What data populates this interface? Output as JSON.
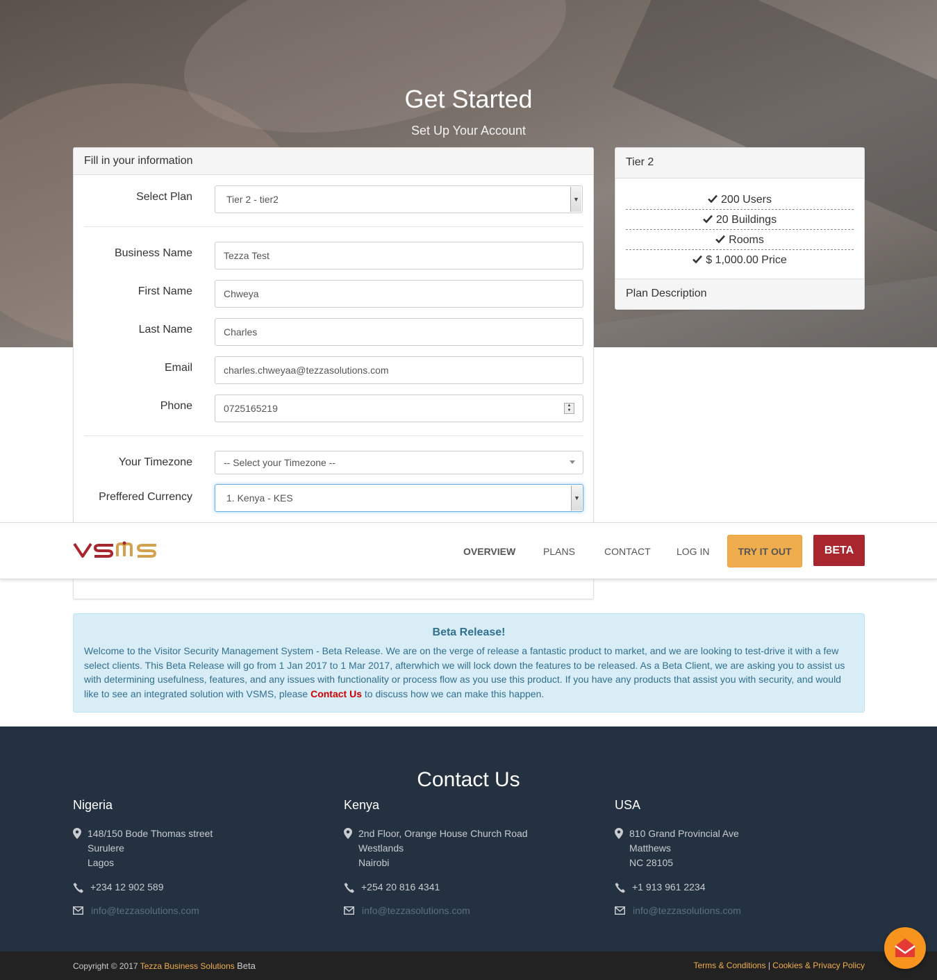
{
  "hero": {
    "title": "Get Started",
    "subtitle": "Set Up Your Account"
  },
  "form": {
    "heading": "Fill in your information",
    "plan_label": "Select Plan",
    "plan_value": "Tier 2 - tier2",
    "business_label": "Business Name",
    "business_value": "Tezza Test",
    "first_label": "First Name",
    "first_value": "Chweya",
    "last_label": "Last Name",
    "last_value": "Charles",
    "email_label": "Email",
    "email_value": "charles.chweyaa@tezzasolutions.com",
    "phone_label": "Phone",
    "phone_value": "0725165219",
    "timezone_label": "Your Timezone",
    "timezone_value": "-- Select your Timezone --",
    "currency_label": "Preffered Currency",
    "currency_value": "1. Kenya - KES"
  },
  "tier": {
    "title": "Tier 2",
    "features": [
      "200 Users",
      "20 Buildings",
      "Rooms",
      "$ 1,000.00 Price"
    ],
    "footer": "Plan Description"
  },
  "nav": {
    "logo": "VSMS",
    "overview": "OVERVIEW",
    "plans": "PLANS",
    "contact": "CONTACT",
    "login": "LOG IN",
    "try": "TRY IT OUT",
    "beta": "BETA"
  },
  "alert": {
    "title": "Beta Release!",
    "text_before": "Welcome to the Visitor Security Management System - Beta Release. We are on the verge of release a fantastic product to market, and we are looking to test-drive it with a few select clients. This Beta Release will go from 1 Jan 2017 to 1 Mar 2017, afterwhich we will lock down the features to be released. As a Beta Client, we are asking you to assist us with determining usefulness, features, and any issues with functionality or process flow as you use this product. If you have any products that assist you with security, and would like to see an integrated solution with VSMS, please ",
    "link": "Contact Us",
    "text_after": " to discuss how we can make this happen."
  },
  "contact": {
    "title": "Contact Us",
    "offices": [
      {
        "country": "Nigeria",
        "addr1": "148/150 Bode Thomas street",
        "addr2": "Surulere",
        "addr3": "Lagos",
        "phone": "+234 12 902 589",
        "email": "info@tezzasolutions.com"
      },
      {
        "country": "Kenya",
        "addr1": "2nd Floor, Orange House Church Road",
        "addr2": "Westlands",
        "addr3": "Nairobi",
        "phone": "+254 20 816 4341",
        "email": "info@tezzasolutions.com"
      },
      {
        "country": "USA",
        "addr1": "810 Grand Provincial Ave",
        "addr2": "Matthews",
        "addr3": "NC 28105",
        "phone": "+1 913 961 2234",
        "email": "info@tezzasolutions.com"
      }
    ]
  },
  "footer": {
    "copyright": "Copyright © 2017",
    "company": "Tezza Business Solutions",
    "beta": "Beta",
    "terms": "Terms & Conditions",
    "privacy": "Cookies & Privacy Policy"
  },
  "colors": {
    "accent": "#f0ad4e",
    "beta": "#a8272e",
    "navy": "#243140",
    "info_bg": "#d9edf7"
  }
}
